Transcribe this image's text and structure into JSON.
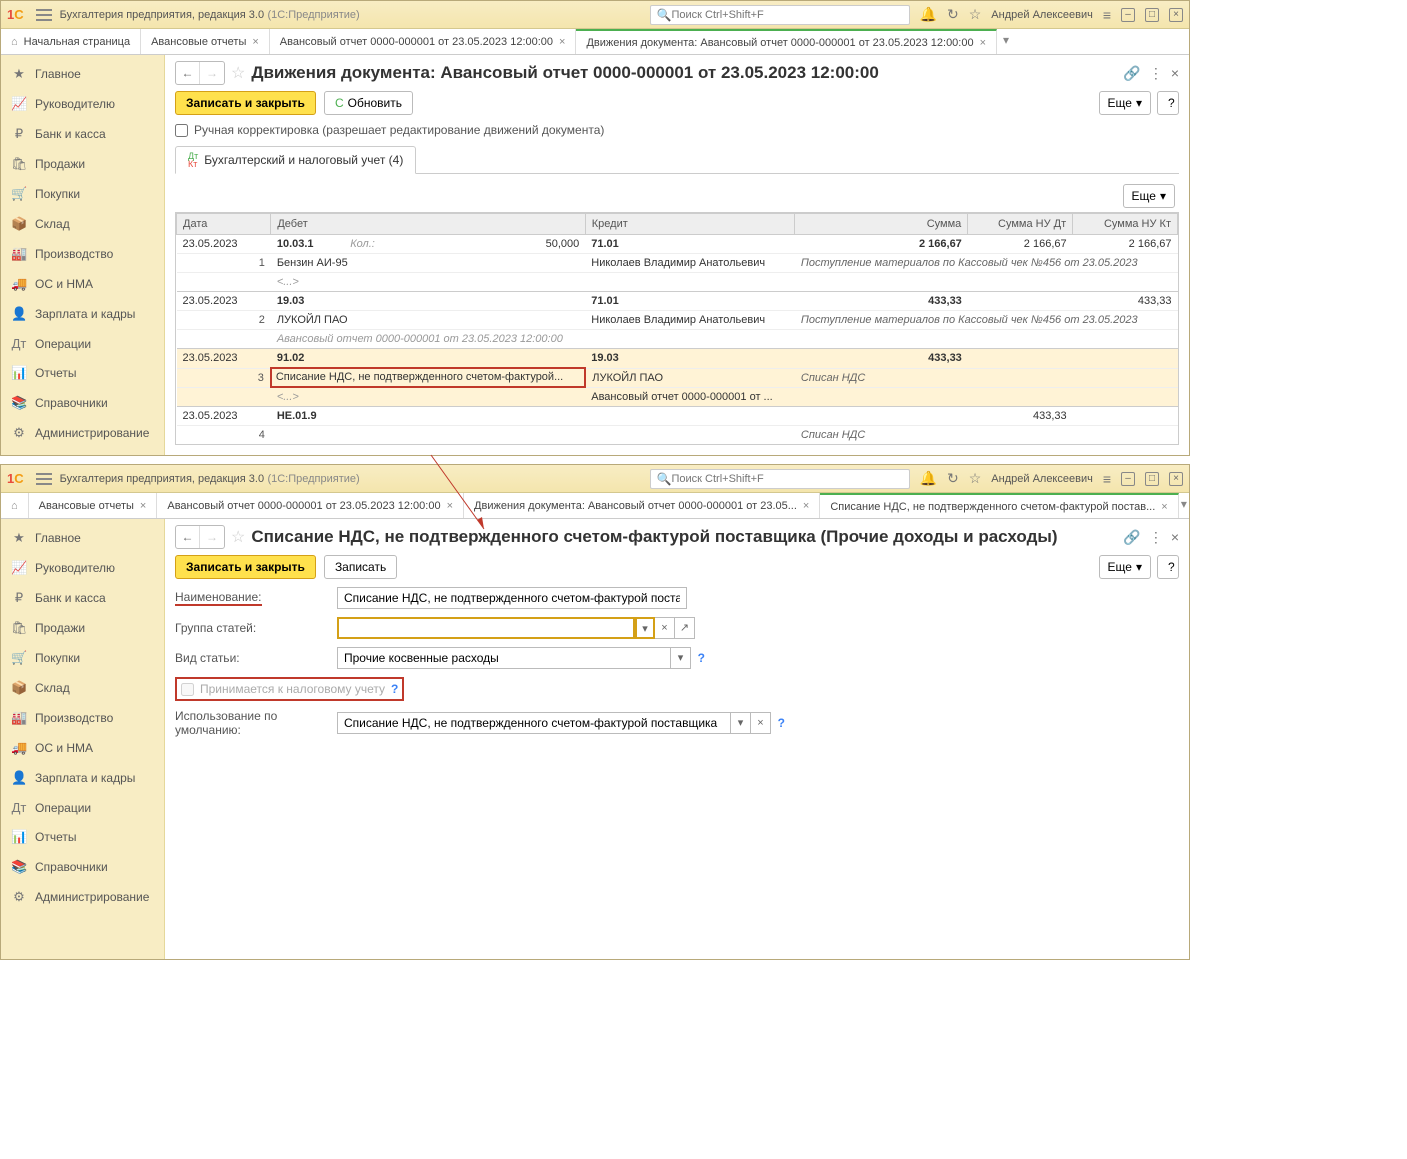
{
  "app": {
    "title": "Бухгалтерия предприятия, редакция 3.0",
    "platform": "(1С:Предприятие)",
    "searchPlaceholder": "Поиск Ctrl+Shift+F",
    "user": "Андрей Алексеевич"
  },
  "sidebar": [
    {
      "icon": "★",
      "label": "Главное"
    },
    {
      "icon": "📈",
      "label": "Руководителю"
    },
    {
      "icon": "₽",
      "label": "Банк и касса"
    },
    {
      "icon": "🛍",
      "label": "Продажи"
    },
    {
      "icon": "🛒",
      "label": "Покупки"
    },
    {
      "icon": "📦",
      "label": "Склад"
    },
    {
      "icon": "🏭",
      "label": "Производство"
    },
    {
      "icon": "🚚",
      "label": "ОС и НМА"
    },
    {
      "icon": "👤",
      "label": "Зарплата и кадры"
    },
    {
      "icon": "Дт",
      "label": "Операции"
    },
    {
      "icon": "📊",
      "label": "Отчеты"
    },
    {
      "icon": "📚",
      "label": "Справочники"
    },
    {
      "icon": "⚙",
      "label": "Администрирование"
    }
  ],
  "screen1": {
    "tabs": [
      {
        "label": "Начальная страница",
        "home": true
      },
      {
        "label": "Авансовые отчеты"
      },
      {
        "label": "Авансовый отчет 0000-000001 от 23.05.2023 12:00:00"
      },
      {
        "label": "Движения документа: Авансовый отчет 0000-000001 от 23.05.2023 12:00:00",
        "active": true
      }
    ],
    "title": "Движения документа: Авансовый отчет 0000-000001 от 23.05.2023 12:00:00",
    "saveClose": "Записать и закрыть",
    "refresh": "Обновить",
    "more": "Еще",
    "manualCheck": "Ручная корректировка (разрешает редактирование движений документа)",
    "subtab": "Бухгалтерский и налоговый учет (4)",
    "cols": {
      "date": "Дата",
      "debit": "Дебет",
      "credit": "Кредит",
      "sum": "Сумма",
      "nudt": "Сумма НУ Дт",
      "nukt": "Сумма НУ Кт"
    },
    "rows": [
      {
        "n": "1",
        "date": "23.05.2023",
        "d1": "10.03.1",
        "dqty": "Кол.:",
        "dqtyv": "50,000",
        "d2": "Бензин АИ-95",
        "d3": "<...>",
        "c1": "71.01",
        "c2": "Николаев Владимир Анатольевич",
        "s": "2 166,67",
        "nudt": "2 166,67",
        "nukt": "2 166,67",
        "note": "Поступление материалов по Кассовый чек №456 от 23.05.2023"
      },
      {
        "n": "2",
        "date": "23.05.2023",
        "d1": "19.03",
        "d2": "ЛУКОЙЛ ПАО",
        "d3": "Авансовый отчет 0000-000001 от 23.05.2023 12:00:00",
        "c1": "71.01",
        "c2": "Николаев Владимир Анатольевич",
        "s": "433,33",
        "nukt": "433,33",
        "note": "Поступление материалов по Кассовый чек №456 от 23.05.2023"
      },
      {
        "n": "3",
        "date": "23.05.2023",
        "d1": "91.02",
        "d2": "Списание НДС, не подтвержденного счетом-фактурой...",
        "d3": "<...>",
        "c1": "19.03",
        "c2": "ЛУКОЙЛ ПАО",
        "c3": "Авансовый отчет 0000-000001 от ...",
        "s": "433,33",
        "note": "Списан НДС",
        "hl": true
      },
      {
        "n": "4",
        "date": "23.05.2023",
        "d1": "НЕ.01.9",
        "nudt": "433,33",
        "note": "Списан НДС"
      }
    ]
  },
  "screen2": {
    "tabs": [
      {
        "label": "Авансовые отчеты"
      },
      {
        "label": "Авансовый отчет 0000-000001 от 23.05.2023 12:00:00"
      },
      {
        "label": "Движения документа: Авансовый отчет 0000-000001 от 23.05..."
      },
      {
        "label": "Списание НДС, не подтвержденного счетом-фактурой постав...",
        "active": true
      }
    ],
    "title": "Списание НДС, не подтвержденного счетом-фактурой поставщика (Прочие доходы и расходы)",
    "saveClose": "Записать и закрыть",
    "save": "Записать",
    "more": "Еще",
    "form": {
      "nameLabel": "Наименование:",
      "nameVal": "Списание НДС, не подтвержденного счетом-фактурой поставщика",
      "groupLabel": "Группа статей:",
      "typeLabel": "Вид статьи:",
      "typeVal": "Прочие косвенные расходы",
      "taxCheck": "Принимается к налоговому учету",
      "defaultLabel": "Использование по умолчанию:",
      "defaultVal": "Списание НДС, не подтвержденного счетом-фактурой поставщика"
    }
  }
}
